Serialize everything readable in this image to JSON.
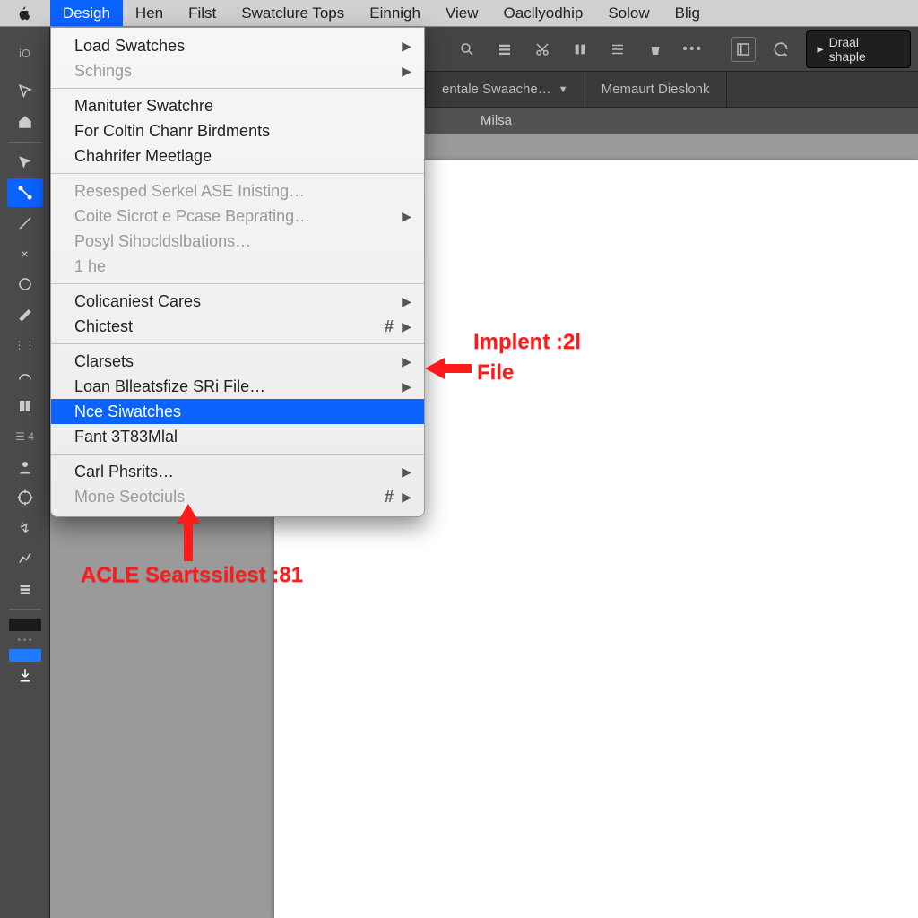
{
  "menubar": {
    "items": [
      {
        "label": "Desigh",
        "active": true
      },
      {
        "label": "Hen"
      },
      {
        "label": "Filst"
      },
      {
        "label": "Swatclure Tops"
      },
      {
        "label": "Einnigh"
      },
      {
        "label": "View"
      },
      {
        "label": "Oacllyodhip"
      },
      {
        "label": "Solow"
      },
      {
        "label": "Blig"
      }
    ]
  },
  "toolbar": {
    "draw_shape_label": "Draal shaple"
  },
  "tabs": [
    {
      "label": "entale Swaache…",
      "dropdown": true
    },
    {
      "label": "Memaurt Dieslonk"
    }
  ],
  "subheader": "Milsa",
  "io_label": "iO",
  "menu": {
    "groups": [
      [
        {
          "label": "Load Swatches",
          "arrow": true
        },
        {
          "label": "Schings",
          "arrow": true,
          "disabled": true
        }
      ],
      [
        {
          "label": "Manituter Swatchre"
        },
        {
          "label": "For Coltin Chanr Birdments"
        },
        {
          "label": "Chahrifer Meetlage"
        }
      ],
      [
        {
          "label": "Resesped Serkel ASE Inisting…",
          "disabled": true
        },
        {
          "label": "Coite Sicrot e Pcase Beprating…",
          "arrow": true,
          "disabled": true
        },
        {
          "label": "Posyl Sihocldslbations…",
          "disabled": true
        },
        {
          "label": "1 he",
          "disabled": true
        }
      ],
      [
        {
          "label": "Colicaniest Cares",
          "arrow": true
        },
        {
          "label": "Chictest",
          "arrow": true,
          "hash": "#"
        }
      ],
      [
        {
          "label": "Clarsets",
          "arrow": true
        },
        {
          "label": "Loan Blleatsfize SRi File…",
          "arrow": true
        },
        {
          "label": "Nce Siwatches",
          "highlight": true
        },
        {
          "label": "Fant 3T83Mlal"
        }
      ],
      [
        {
          "label": "Carl Phsrits…",
          "arrow": true
        },
        {
          "label": "Mone Seotciuls",
          "arrow": true,
          "hash": "#",
          "disabled": true
        }
      ]
    ]
  },
  "annotations": {
    "right1": "Implent :2l",
    "right2": "File",
    "bottom": "ACLE Seartssilest :81"
  }
}
